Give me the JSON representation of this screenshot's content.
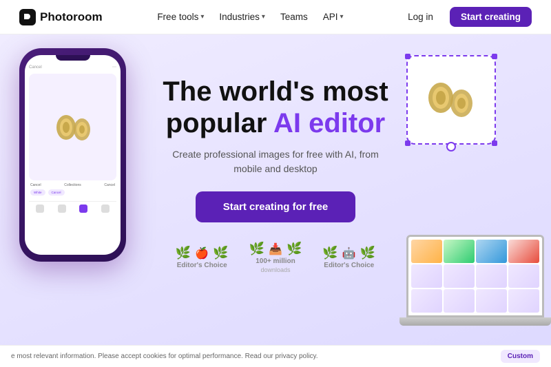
{
  "brand": {
    "name": "Photoroom"
  },
  "navbar": {
    "logo_text": "Photoroom",
    "links": [
      {
        "label": "Free tools",
        "has_dropdown": true
      },
      {
        "label": "Industries",
        "has_dropdown": true
      },
      {
        "label": "Teams",
        "has_dropdown": false
      },
      {
        "label": "API",
        "has_dropdown": true
      }
    ],
    "login_label": "Log in",
    "cta_label": "Start creating"
  },
  "hero": {
    "title_part1": "The world's most",
    "title_part2": "popular ",
    "title_accent": "AI editor",
    "subtitle": "Create professional images for free with AI, from mobile and desktop",
    "cta_label": "Start creating for free"
  },
  "badges": [
    {
      "icon": "🍎",
      "label": "Editor's Choice",
      "sublabel": ""
    },
    {
      "icon": "📥",
      "label": "100+ million",
      "sublabel": "downloads"
    },
    {
      "icon": "🤖",
      "label": "Editor's Choice",
      "sublabel": ""
    }
  ],
  "cookie": {
    "text": "e most relevant information. Please accept cookies for optimal performance. Read our privacy policy.",
    "button_label": "Custom"
  }
}
